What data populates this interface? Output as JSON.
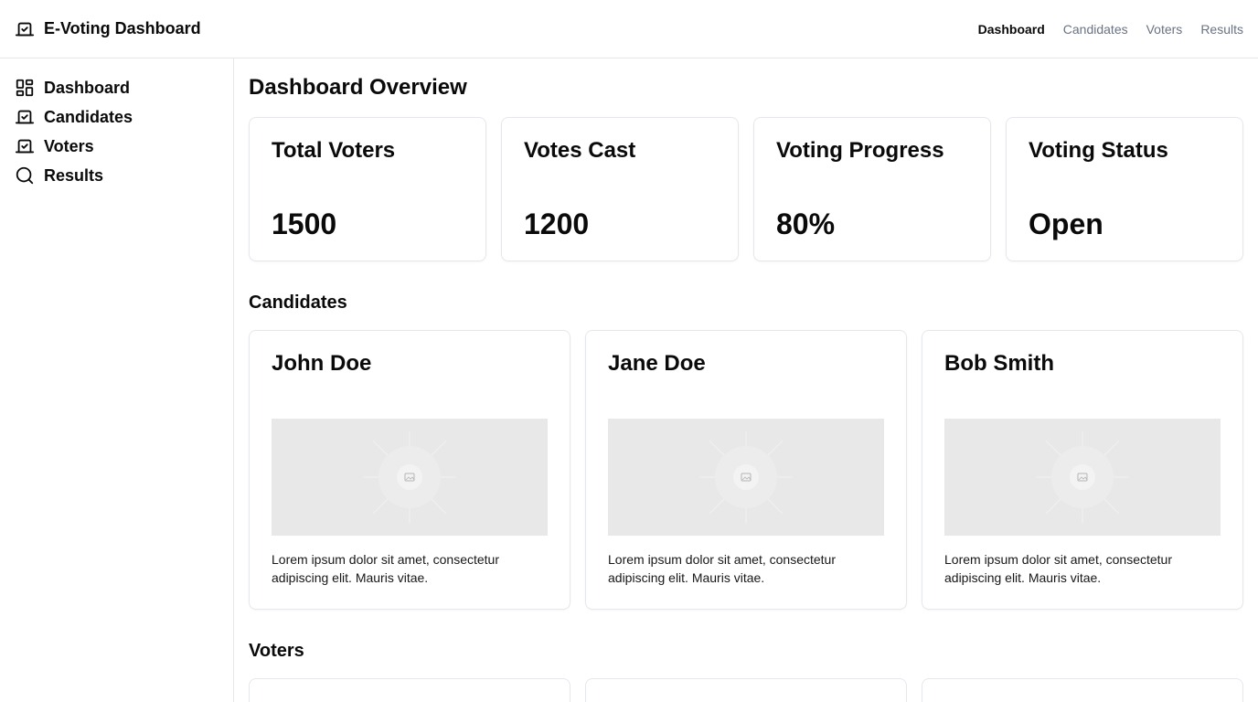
{
  "app": {
    "title": "E-Voting Dashboard",
    "logo_icon": "ballot-check-icon"
  },
  "topnav": {
    "items": [
      {
        "label": "Dashboard",
        "active": true
      },
      {
        "label": "Candidates",
        "active": false
      },
      {
        "label": "Voters",
        "active": false
      },
      {
        "label": "Results",
        "active": false
      }
    ]
  },
  "sidebar": {
    "items": [
      {
        "label": "Dashboard",
        "icon": "layout-grid-icon"
      },
      {
        "label": "Candidates",
        "icon": "ballot-check-icon"
      },
      {
        "label": "Voters",
        "icon": "ballot-check-icon"
      },
      {
        "label": "Results",
        "icon": "search-icon"
      }
    ]
  },
  "main": {
    "page_title": "Dashboard Overview",
    "stats": [
      {
        "label": "Total Voters",
        "value": "1500"
      },
      {
        "label": "Votes Cast",
        "value": "1200"
      },
      {
        "label": "Voting Progress",
        "value": "80%"
      },
      {
        "label": "Voting Status",
        "value": "Open"
      }
    ],
    "candidates_title": "Candidates",
    "candidates": [
      {
        "name": "John Doe",
        "description": "Lorem ipsum dolor sit amet, consectetur adipiscing elit. Mauris vitae."
      },
      {
        "name": "Jane Doe",
        "description": "Lorem ipsum dolor sit amet, consectetur adipiscing elit. Mauris vitae."
      },
      {
        "name": "Bob Smith",
        "description": "Lorem ipsum dolor sit amet, consectetur adipiscing elit. Mauris vitae."
      }
    ],
    "voters_title": "Voters"
  },
  "colors": {
    "border": "#e5e7eb",
    "muted_text": "#6b7280",
    "placeholder_bg": "#e8e8e8"
  }
}
